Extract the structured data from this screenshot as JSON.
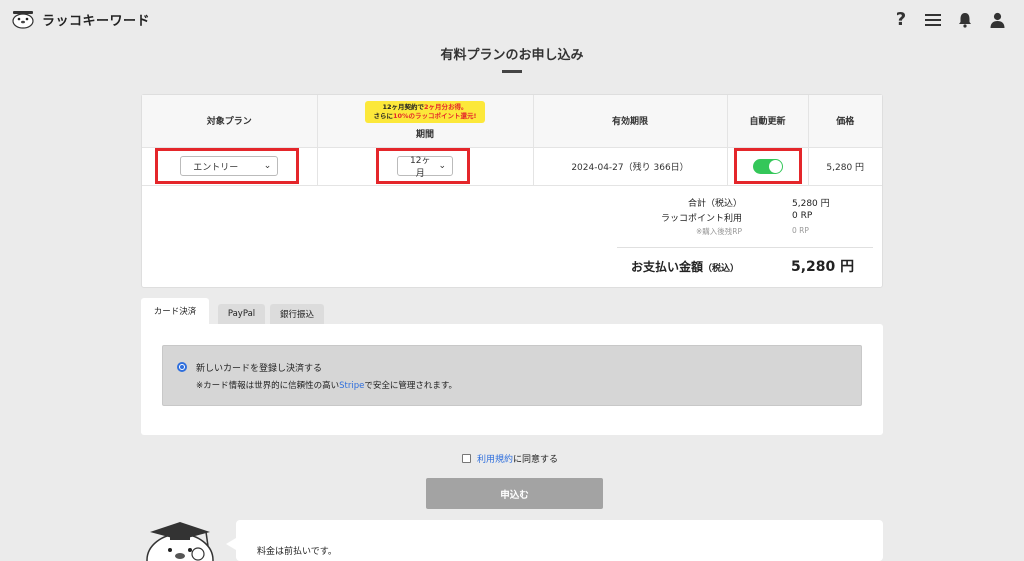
{
  "header": {
    "logo_text": "ラッコキーワード",
    "help_glyph": "?"
  },
  "page_title": "有料プランのお申し込み",
  "plan_table": {
    "headers": {
      "plan": "対象プラン",
      "period": "期間",
      "expiry": "有効期限",
      "auto_renew": "自動更新",
      "price": "価格"
    },
    "promo": {
      "line1_a": "12ヶ月契約で",
      "line1_b": "2ヶ月分お得。",
      "line2_a": "さらに",
      "line2_b": "10%のラッコポイント還元!"
    },
    "plan_select": {
      "value": "エントリー"
    },
    "period_select": {
      "value": "12ヶ月"
    },
    "expiry_value": "2024-04-27（残り 366日）",
    "auto_renew_on": true,
    "price_value": "5,280 円"
  },
  "summary": {
    "total_label": "合計（税込）",
    "total_value": "5,280 円",
    "points_label": "ラッコポイント利用",
    "points_value": "0 RP",
    "remaining_label": "※購入後残RP",
    "remaining_value": "0 RP",
    "payment_label": "お支払い金額",
    "payment_tax": "（税込）",
    "payment_value": "5,280 円"
  },
  "tabs": [
    {
      "label": "カード決済",
      "active": true
    },
    {
      "label": "PayPal",
      "active": false
    },
    {
      "label": "銀行振込",
      "active": false
    }
  ],
  "card": {
    "option_label": "新しいカードを登録し決済する",
    "note_before": "※カード情報は世界的に信頼性の高い",
    "note_link": "Stripe",
    "note_after": "で安全に管理されます。"
  },
  "agree": {
    "link": "利用規約",
    "text": "に同意する"
  },
  "submit_label": "申込む",
  "bubble_text": "料金は前払いです。",
  "colors": {
    "accent": "#2f6fdd",
    "highlight_red": "#e4262a",
    "toggle_on": "#34c759",
    "promo_yellow": "#fce83a"
  }
}
